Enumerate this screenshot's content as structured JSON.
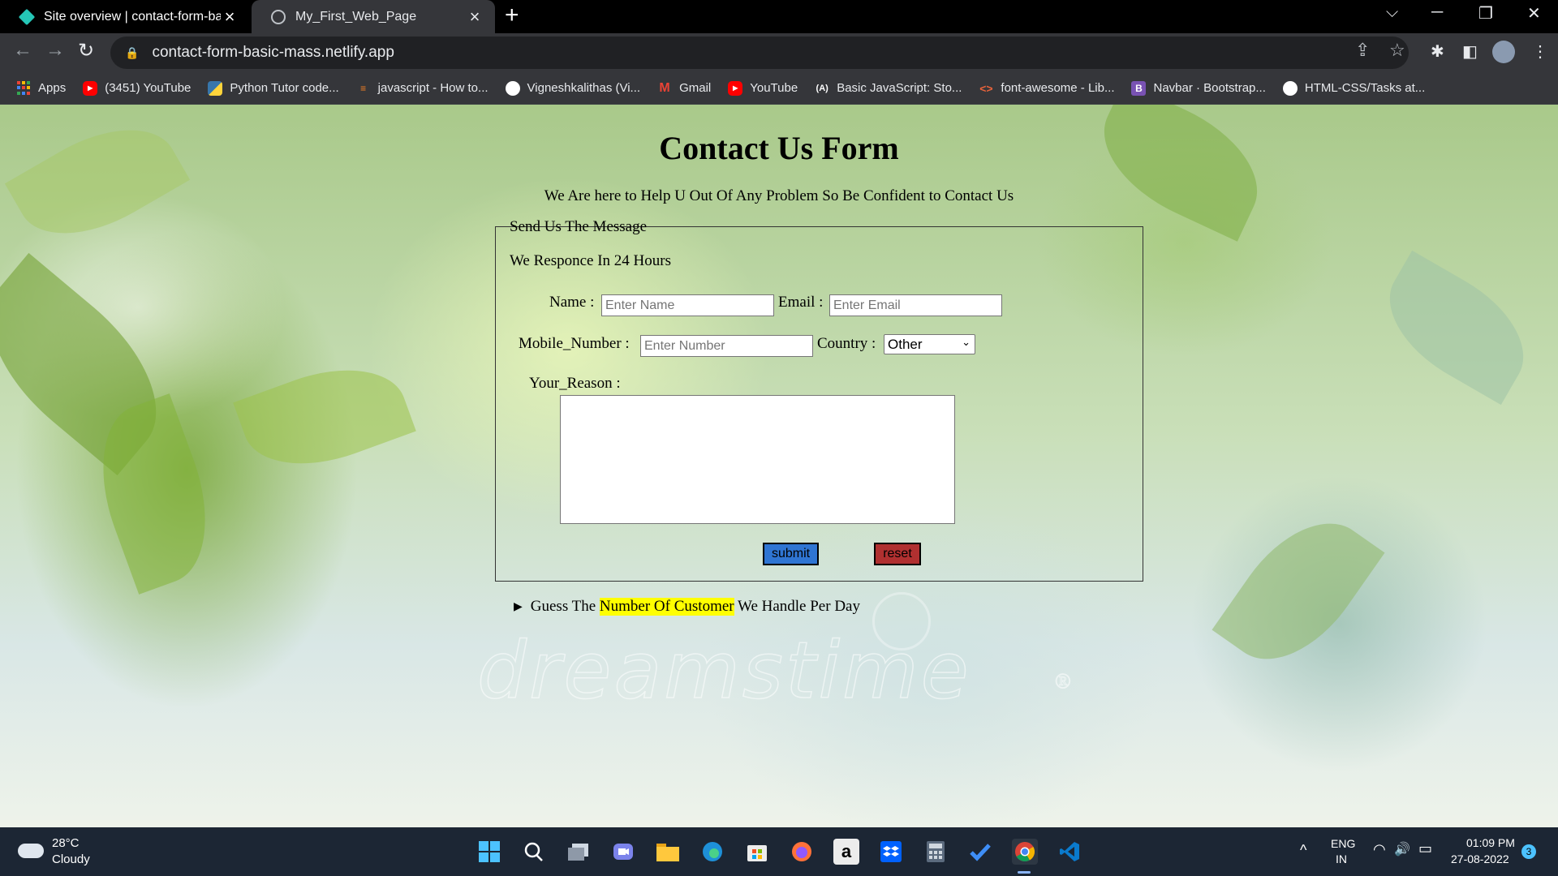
{
  "browser": {
    "tabs": [
      {
        "title": "Site overview | contact-form-basic",
        "favicon": "netlify-icon",
        "close": "×"
      },
      {
        "title": "My_First_Web_Page",
        "favicon": "globe-icon",
        "close": "×"
      }
    ],
    "new_tab": "+",
    "window_controls": {
      "search_tabs": "⌵",
      "minimize": "─",
      "restore": "❐",
      "close": "✕"
    },
    "nav": {
      "back": "←",
      "forward": "→",
      "reload": "↻"
    },
    "url": "contact-form-basic-mass.netlify.app",
    "lock": "🔒",
    "omnibox_icons": {
      "share": "⇪",
      "star": "☆"
    },
    "toolbar_icons": {
      "extensions": "✱",
      "side_panel": "◧",
      "menu": "⋮"
    },
    "bookmarks": [
      {
        "label": "Apps",
        "icon": "apps-icon"
      },
      {
        "label": "(3451) YouTube",
        "icon": "youtube-icon"
      },
      {
        "label": "Python Tutor code...",
        "icon": "python-icon"
      },
      {
        "label": "javascript - How to...",
        "icon": "stackoverflow-icon"
      },
      {
        "label": "Vigneshkalithas (Vi...",
        "icon": "github-icon"
      },
      {
        "label": "Gmail",
        "icon": "gmail-icon"
      },
      {
        "label": "YouTube",
        "icon": "youtube-icon"
      },
      {
        "label": "Basic JavaScript: Sto...",
        "icon": "freecodecamp-icon"
      },
      {
        "label": "font-awesome - Lib...",
        "icon": "cdnjs-icon"
      },
      {
        "label": "Navbar · Bootstrap...",
        "icon": "bootstrap-icon"
      },
      {
        "label": "HTML-CSS/Tasks at...",
        "icon": "github-icon"
      }
    ]
  },
  "page": {
    "title": "Contact Us Form",
    "subtitle": "We Are here to Help U Out Of Any Problem So Be Confident to Contact Us",
    "form": {
      "legend": "Send Us The Message",
      "response_note": "We Responce In 24 Hours",
      "name_label": "Name :",
      "name_placeholder": "Enter Name",
      "email_label": "Email :",
      "email_placeholder": "Enter Email",
      "mobile_label": "Mobile_Number :",
      "mobile_placeholder": "Enter Number",
      "country_label": "Country :",
      "country_selected": "Other",
      "reason_label": "Your_Reason :",
      "reason_value": "",
      "submit_label": "submit",
      "reset_label": "reset"
    },
    "details": {
      "before": "Guess The ",
      "highlight": "Number Of Customer",
      "after": " We Handle Per Day"
    },
    "watermark": "dreamstime",
    "watermark_reg": "®"
  },
  "taskbar": {
    "weather_temp": "28°C",
    "weather_condition": "Cloudy",
    "apps": [
      "start-icon",
      "search-icon",
      "task-view-icon",
      "chat-icon",
      "file-explorer-icon",
      "edge-icon",
      "store-icon",
      "firefox-icon",
      "amazon-icon",
      "dropbox-icon",
      "calculator-icon",
      "todo-icon",
      "chrome-icon",
      "vscode-icon"
    ],
    "tray": {
      "chevron": "^",
      "lang_top": "ENG",
      "lang_bottom": "IN",
      "wifi": "◠",
      "volume": "🔊",
      "battery": "▭",
      "time": "01:09 PM",
      "date": "27-08-2022",
      "notifications": "3"
    }
  }
}
